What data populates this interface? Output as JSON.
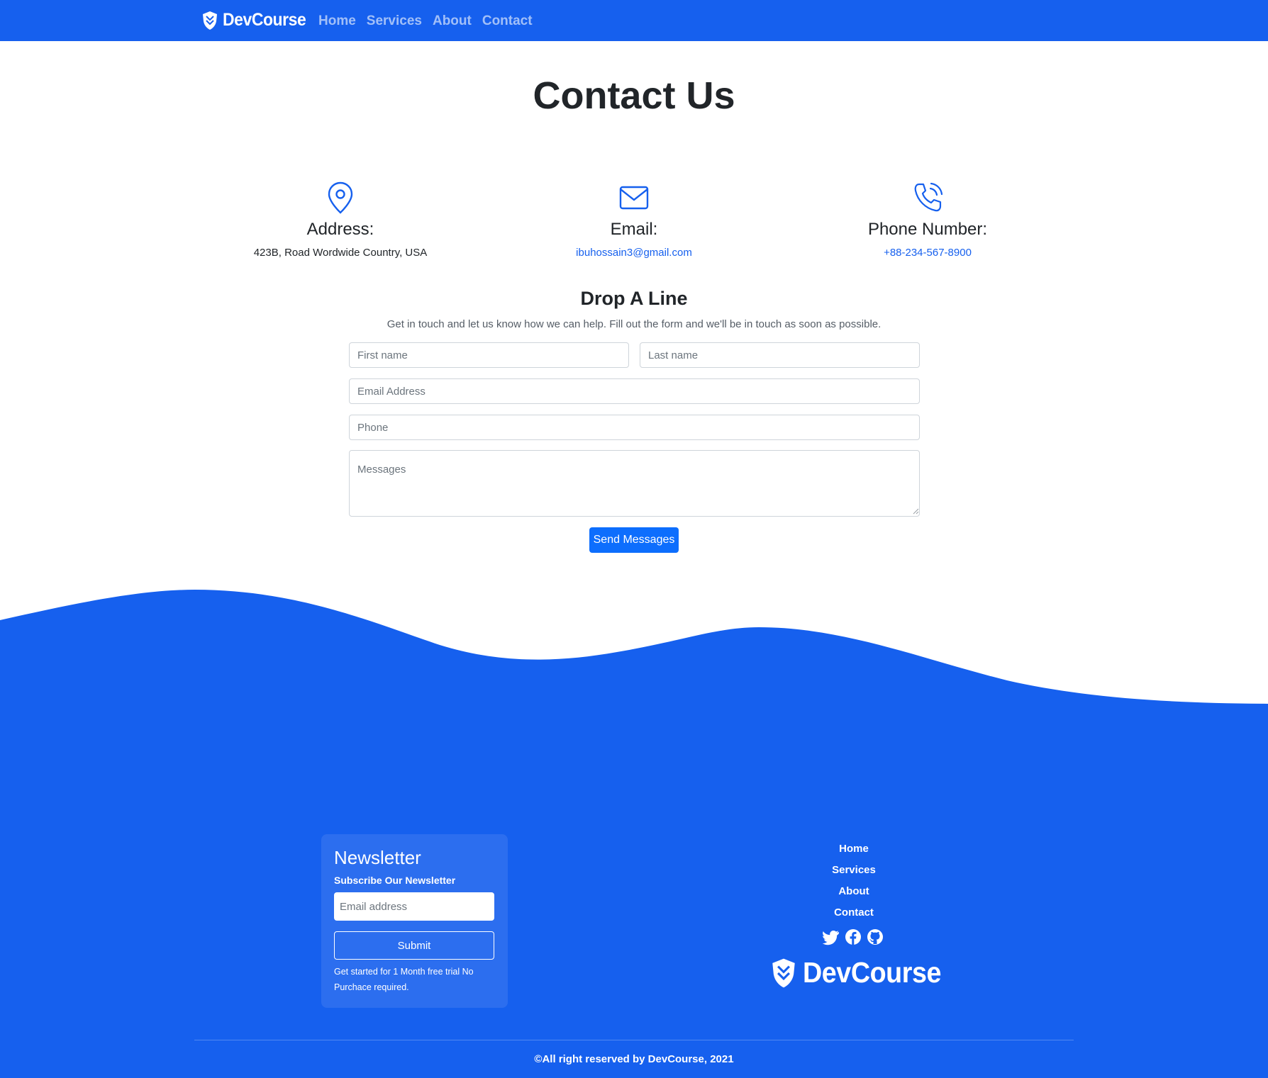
{
  "brand": {
    "name": "DevCourse"
  },
  "nav": {
    "items": [
      "Home",
      "Services",
      "About",
      "Contact"
    ]
  },
  "page": {
    "title": "Contact Us"
  },
  "info": {
    "address": {
      "label": "Address:",
      "value": "423B, Road Wordwide Country, USA",
      "icon": "location-pin-icon"
    },
    "email": {
      "label": "Email:",
      "value": "ibuhossain3@gmail.com",
      "icon": "envelope-icon"
    },
    "phone": {
      "label": "Phone Number:",
      "value": "+88-234-567-8900",
      "icon": "phone-icon"
    }
  },
  "form": {
    "title": "Drop A Line",
    "subtitle": "Get in touch and let us know how we can help. Fill out the form and we'll be in touch as soon as possible.",
    "first_name_placeholder": "First name",
    "last_name_placeholder": "Last name",
    "email_placeholder": "Email Address",
    "phone_placeholder": "Phone",
    "message_placeholder": "Messages",
    "send_label": "Send Messages"
  },
  "newsletter": {
    "title": "Newsletter",
    "subtitle": "Subscribe Our Newsletter",
    "email_placeholder": "Email address",
    "submit_label": "Submit",
    "note": "Get started for 1 Month free trial No Purchace required."
  },
  "footer": {
    "links": [
      "Home",
      "Services",
      "About",
      "Contact"
    ],
    "socials": [
      "twitter-icon",
      "facebook-icon",
      "github-icon"
    ],
    "brand": "DevCourse",
    "copyright": "©All right reserved by DevCourse, 2021"
  },
  "colors": {
    "primary": "#1660ee",
    "button": "#0d6efd",
    "newsletter_card": "#2c6eef",
    "text": "#212529"
  }
}
